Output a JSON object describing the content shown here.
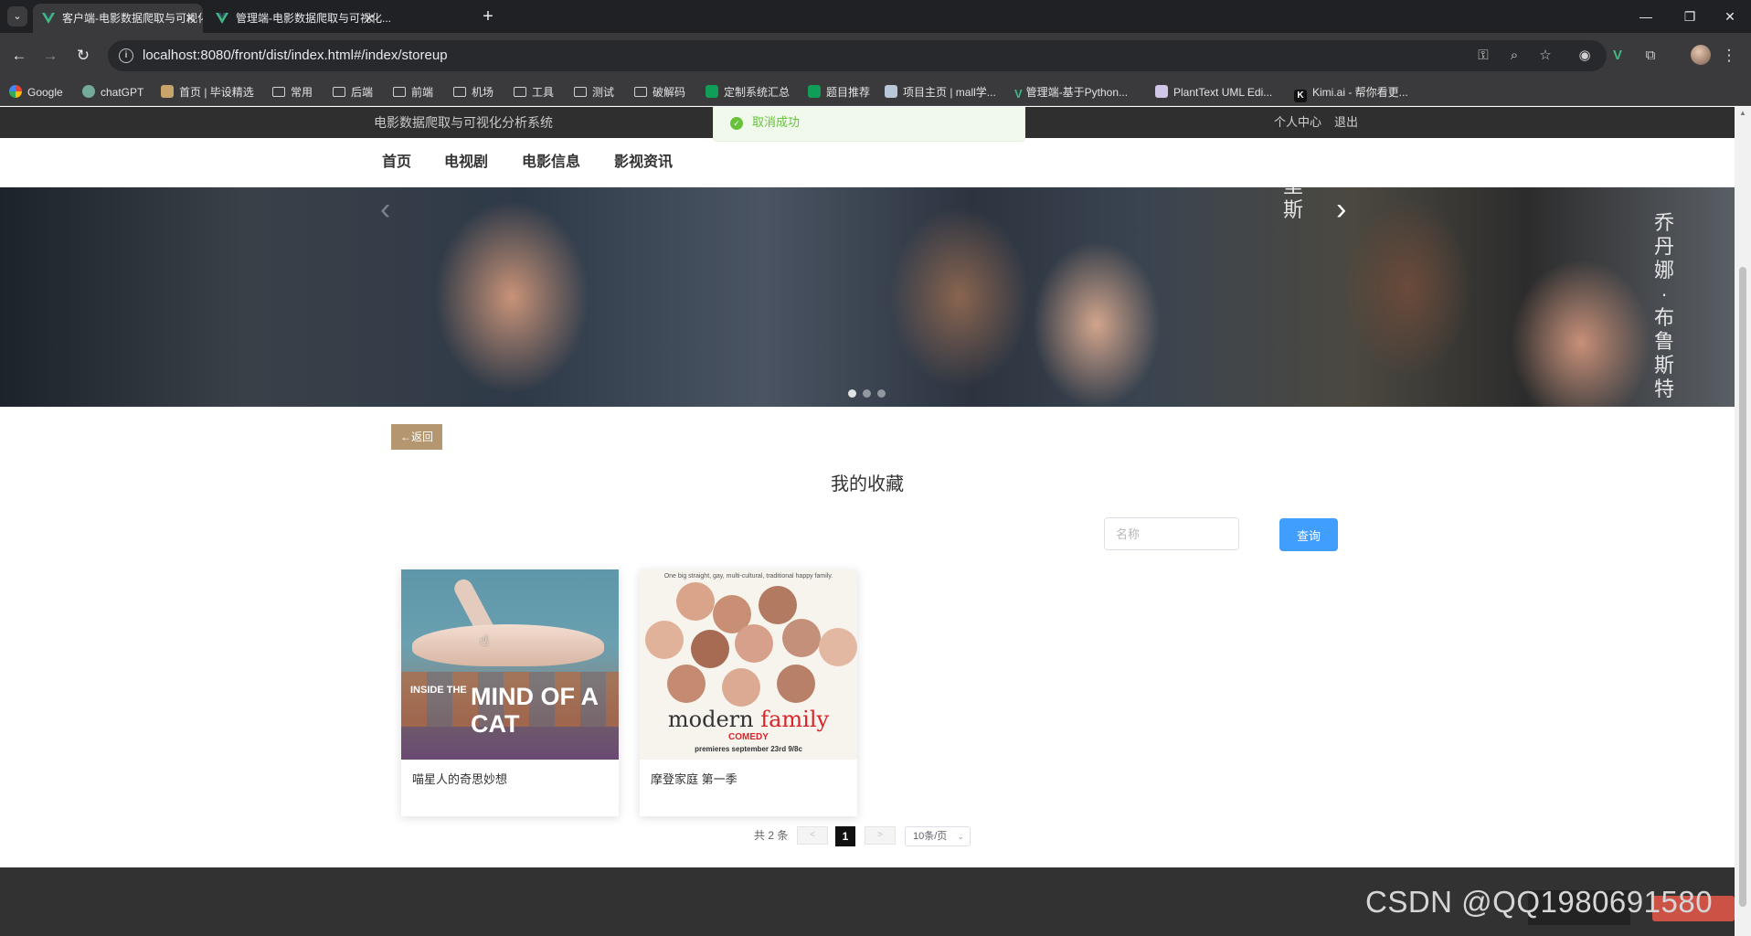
{
  "browser": {
    "tabs": [
      {
        "title": "客户端-电影数据爬取与可视化...",
        "active": true
      },
      {
        "title": "管理端-电影数据爬取与可视化...",
        "active": false
      }
    ],
    "url": "localhost:8080/front/dist/index.html#/index/storeup",
    "bookmarks": [
      {
        "label": "Google",
        "icon": "google-icon"
      },
      {
        "label": "chatGPT",
        "icon": "chatgpt-icon"
      },
      {
        "label": "首页 | 毕设精选",
        "icon": "bookmark-page-icon"
      },
      {
        "label": "常用",
        "icon": "folder-icon"
      },
      {
        "label": "后端",
        "icon": "folder-icon"
      },
      {
        "label": "前端",
        "icon": "folder-icon"
      },
      {
        "label": "机场",
        "icon": "folder-icon"
      },
      {
        "label": "工具",
        "icon": "folder-icon"
      },
      {
        "label": "测试",
        "icon": "folder-icon"
      },
      {
        "label": "破解码",
        "icon": "folder-icon"
      },
      {
        "label": "定制系统汇总",
        "icon": "sheet-icon"
      },
      {
        "label": "题目推荐",
        "icon": "sheet-icon"
      },
      {
        "label": "项目主页 | mall学...",
        "icon": "bookmark-page-icon"
      },
      {
        "label": "管理端-基于Python...",
        "icon": "vue-icon"
      },
      {
        "label": "PlantText UML Edi...",
        "icon": "plant-icon"
      },
      {
        "label": "Kimi.ai - 帮你看更...",
        "icon": "kimi-icon"
      }
    ]
  },
  "site": {
    "title": "电影数据爬取与可视化分析系统",
    "user_center": "个人中心",
    "logout": "退出",
    "nav": [
      "首页",
      "电视剧",
      "电影信息",
      "影视资讯"
    ]
  },
  "banner": {
    "vertical_text_1": "里斯",
    "vertical_text_2": "乔丹娜·布鲁斯特"
  },
  "toast": {
    "message": "取消成功"
  },
  "back_button": "←返回",
  "section_title": "我的收藏",
  "search": {
    "placeholder": "名称",
    "button": "查询"
  },
  "cards": [
    {
      "name": "喵星人的奇思妙想",
      "poster_text_small": "INSIDE THE",
      "poster_text_big": "MIND OF A CAT"
    },
    {
      "name": "摩登家庭 第一季",
      "poster_tagline": "One big straight, gay, multi-cultural, traditional happy family.",
      "poster_title_part1": "modern",
      "poster_title_part2": "family",
      "poster_comedy": "COMEDY",
      "poster_premiere": "premieres september 23rd 9/8c"
    }
  ],
  "pagination": {
    "total": "共 2 条",
    "prev": "<",
    "current": "1",
    "next": ">",
    "page_size": "10条/页"
  },
  "watermark": "CSDN @QQ1980691580",
  "colors": {
    "topbar": "#2f2f2f",
    "back_button": "#b49770",
    "primary": "#409eff",
    "toast_bg": "#f0f9eb",
    "toast_text": "#67c23a",
    "footer": "#323232"
  }
}
